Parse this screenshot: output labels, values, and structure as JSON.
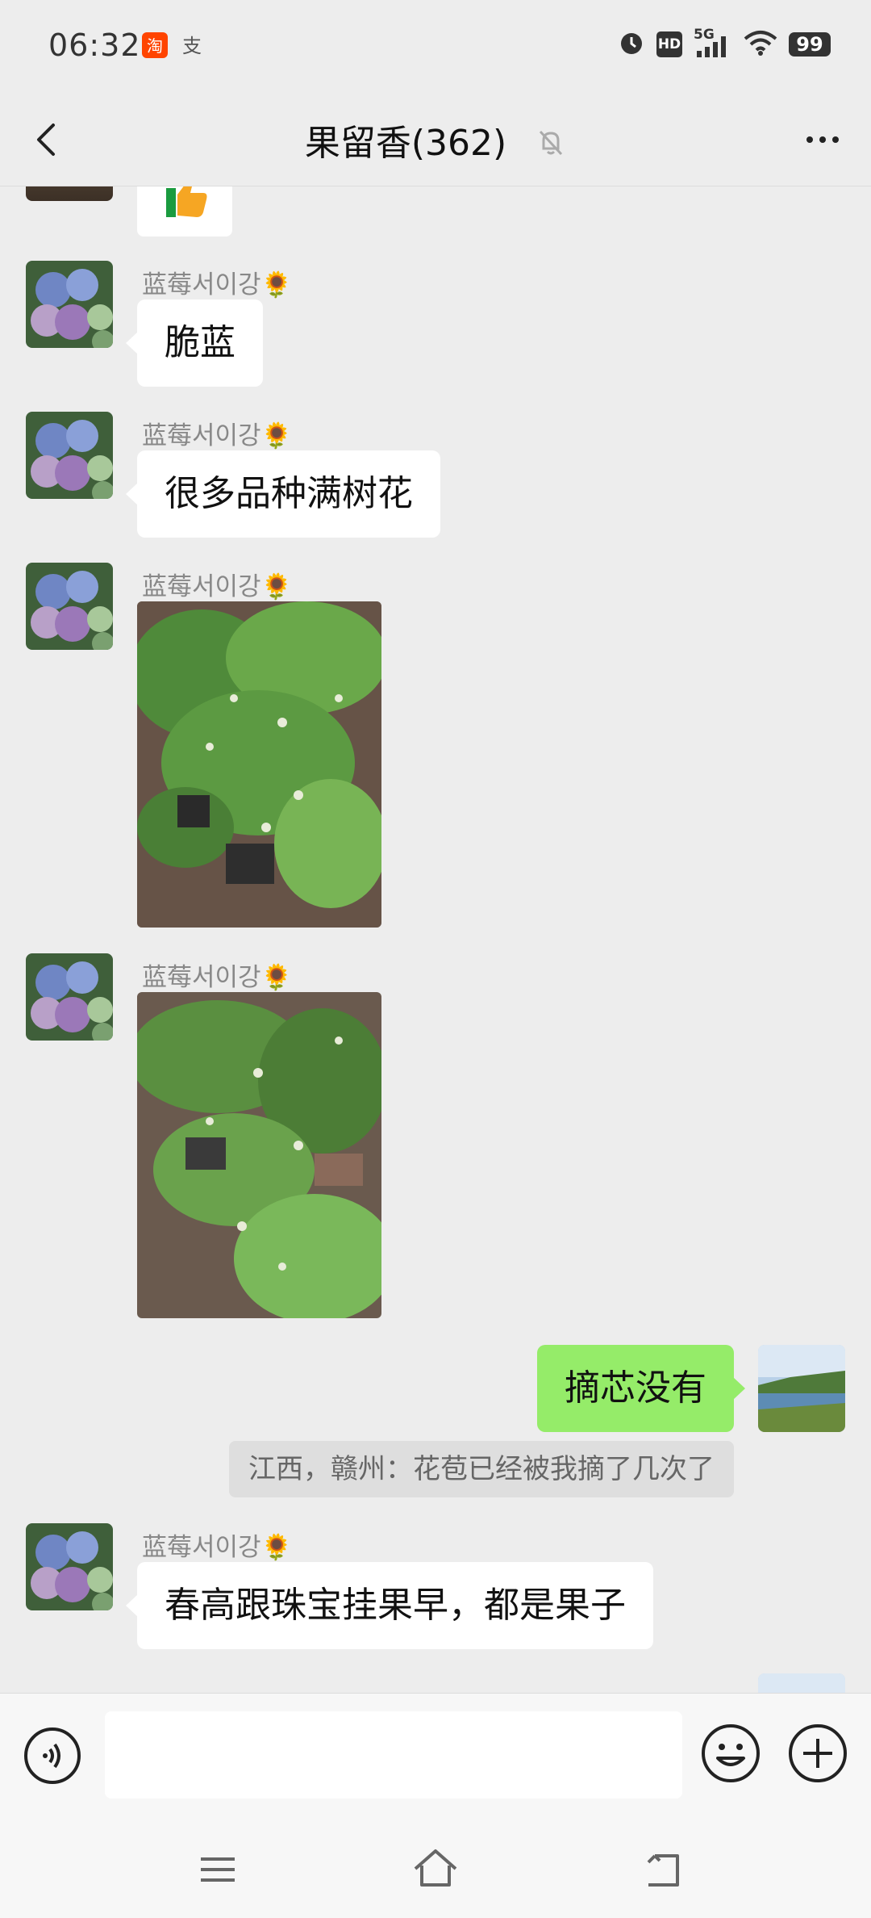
{
  "status_bar": {
    "time": "06:32",
    "app_icons": [
      "taobao-icon",
      "alipay-icon"
    ],
    "indicators": [
      "alarm-icon",
      "hd-icon",
      "5g-signal-icon",
      "wifi-icon"
    ],
    "network": "5G",
    "hd": "HD",
    "battery": "99"
  },
  "header": {
    "back_icon": "chevron-left-icon",
    "title": "果留香(362)",
    "mute_icon": "bell-off-icon",
    "more_icon": "ellipsis-icon"
  },
  "messages": [
    {
      "type": "sticker",
      "side": "left",
      "content": "thumbs-up"
    },
    {
      "type": "text",
      "side": "left",
      "sender": "蓝莓서이강🌻",
      "text": "脆蓝"
    },
    {
      "type": "text",
      "side": "left",
      "sender": "蓝莓서이강🌻",
      "text": "很多品种满树花"
    },
    {
      "type": "image",
      "side": "left",
      "sender": "蓝莓서이강🌻",
      "content": "blueberry-bushes-flowering-photo-1"
    },
    {
      "type": "image",
      "side": "left",
      "sender": "蓝莓서이강🌻",
      "content": "blueberry-bushes-flowering-photo-2"
    },
    {
      "type": "text",
      "side": "right",
      "text": "摘芯没有",
      "quote": "江西，赣州：花苞已经被我摘了几次了"
    },
    {
      "type": "text",
      "side": "left",
      "sender": "蓝莓서이강🌻",
      "text": "春高跟珠宝挂果早，都是果子"
    }
  ],
  "input_bar": {
    "voice_icon": "voice-icon",
    "input_value": "",
    "emoji_icon": "emoji-icon",
    "plus_icon": "plus-icon"
  },
  "nav_bar": {
    "items": [
      "menu-icon",
      "home-icon",
      "back-icon"
    ]
  },
  "colors": {
    "background": "#ededed",
    "self_bubble": "#95ec69",
    "other_bubble": "#ffffff",
    "nickname": "#888888"
  }
}
